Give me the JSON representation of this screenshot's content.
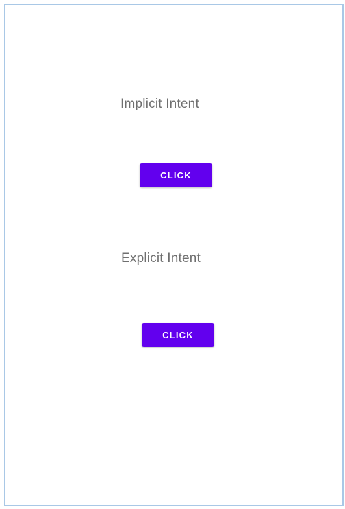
{
  "colors": {
    "accent": "#6200ee",
    "label_text": "#6f6f6f",
    "frame_border": "#a9c8e6",
    "background": "#ffffff"
  },
  "implicit": {
    "label": "Implicit Intent",
    "button_label": "CLICK"
  },
  "explicit": {
    "label": "Explicit Intent",
    "button_label": "CLICK"
  }
}
